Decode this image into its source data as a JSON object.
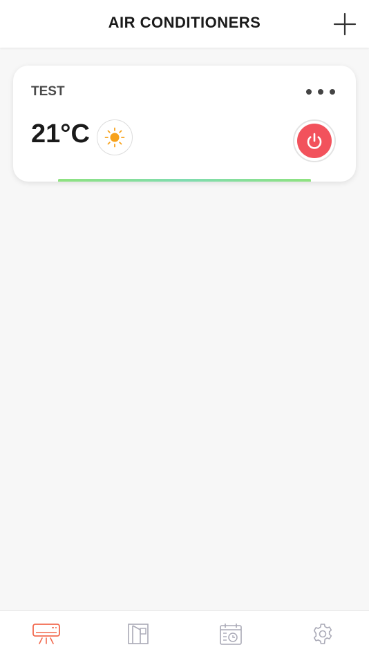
{
  "header": {
    "title": "AIR CONDITIONERS",
    "add_icon": "plus-icon"
  },
  "devices": [
    {
      "name": "TEST",
      "temperature": "21°C",
      "mode_icon": "sun-icon",
      "mode": "heat",
      "power_icon": "power-icon",
      "power_color": "#f2525c",
      "status_color": "#8ee27f",
      "menu_icon": "more-dots-icon"
    }
  ],
  "bottom_nav": {
    "items": [
      {
        "id": "air-conditioners",
        "icon": "air-conditioner-icon",
        "active": true
      },
      {
        "id": "rooms",
        "icon": "room-door-icon",
        "active": false
      },
      {
        "id": "schedule",
        "icon": "calendar-clock-icon",
        "active": false
      },
      {
        "id": "settings",
        "icon": "gear-icon",
        "active": false
      }
    ],
    "active_color": "#f26a4f",
    "inactive_color": "#a9a9b6"
  }
}
